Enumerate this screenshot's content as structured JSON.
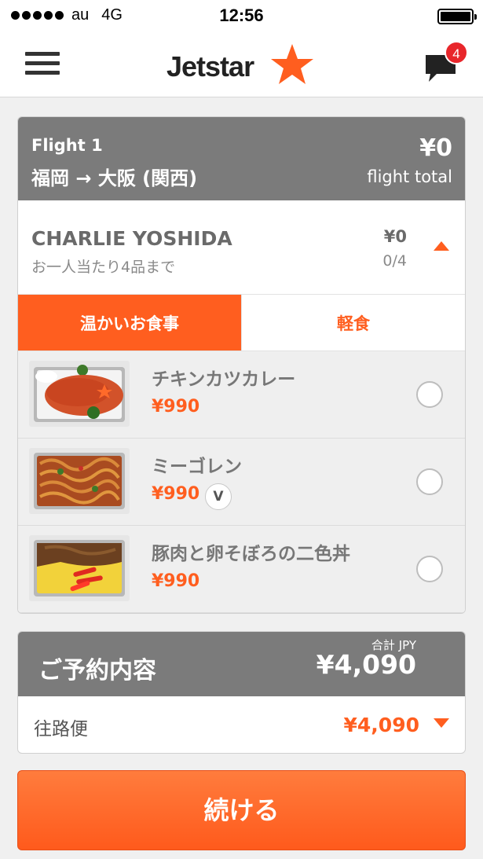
{
  "status_bar": {
    "carrier": "au",
    "network": "4G",
    "time": "12:56"
  },
  "nav": {
    "logo_text": "Jetstar",
    "notification_count": "4",
    "brand_color": "#ff5e1f"
  },
  "flight": {
    "label": "Flight 1",
    "route": "福岡 → 大阪 (関西)",
    "amount": "¥0",
    "total_label": "flight total"
  },
  "passenger": {
    "name": "CHARLIE YOSHIDA",
    "limit_note": "お一人当たり4品まで",
    "amount": "¥0",
    "count": "0/4"
  },
  "tabs": [
    {
      "label": "温かいお食事",
      "active": true
    },
    {
      "label": "軽食",
      "active": false
    }
  ],
  "meals": [
    {
      "name": "チキンカツカレー",
      "price": "¥990",
      "image": "chicken-katsu-curry"
    },
    {
      "name": "ミーゴレン",
      "price": "¥990",
      "badge": "V",
      "image": "mee-goreng"
    },
    {
      "name": "豚肉と卵そぼろの二色丼",
      "price": "¥990",
      "image": "pork-egg-soboro-bowl"
    }
  ],
  "summary": {
    "title": "ご予約内容",
    "currency_label": "合計 JPY",
    "total": "¥4,090",
    "row_label": "往路便",
    "row_amount": "¥4,090"
  },
  "continue_label": "続ける"
}
